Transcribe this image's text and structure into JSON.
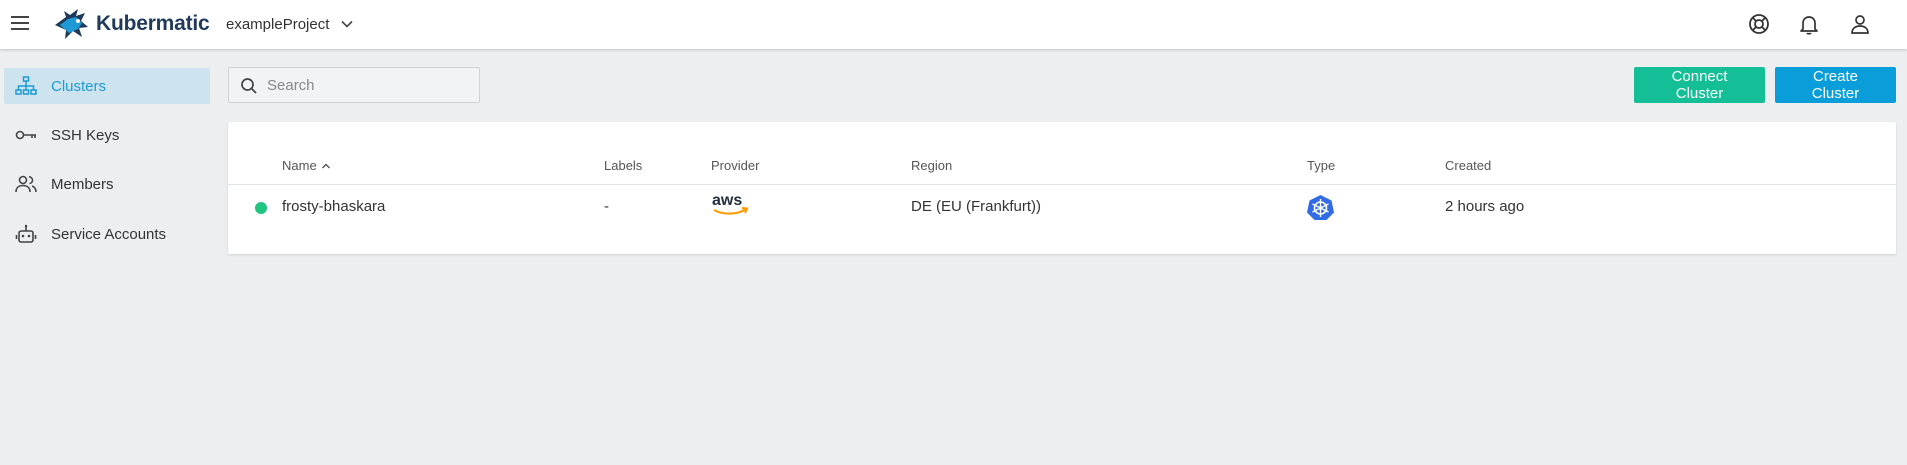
{
  "app": {
    "name": "Kubermatic"
  },
  "header": {
    "project": "exampleProject",
    "icons": [
      "menu-icon",
      "help-icon",
      "bell-icon",
      "user-icon"
    ]
  },
  "sidebar": {
    "items": [
      {
        "label": "Clusters",
        "icon": "sitemap-icon",
        "active": true
      },
      {
        "label": "SSH Keys",
        "icon": "key-icon",
        "active": false
      },
      {
        "label": "Members",
        "icon": "people-icon",
        "active": false
      },
      {
        "label": "Service Accounts",
        "icon": "robot-icon",
        "active": false
      }
    ]
  },
  "toolbar": {
    "search_placeholder": "Search",
    "connect_label": "Connect Cluster",
    "create_label": "Create Cluster"
  },
  "table": {
    "columns": [
      "Name",
      "Labels",
      "Provider",
      "Region",
      "Type",
      "Created"
    ],
    "sort": {
      "column": "Name",
      "direction": "asc"
    },
    "rows": [
      {
        "status": "running",
        "name": "frosty-bhaskara",
        "labels": "-",
        "provider": "aws",
        "region": "DE (EU (Frankfurt))",
        "type": "kubernetes",
        "created": "2 hours ago"
      }
    ]
  },
  "colors": {
    "accent": "#099dd9",
    "connect": "#14bf97",
    "status_running": "#20c57f",
    "k8s": "#326ce5"
  }
}
